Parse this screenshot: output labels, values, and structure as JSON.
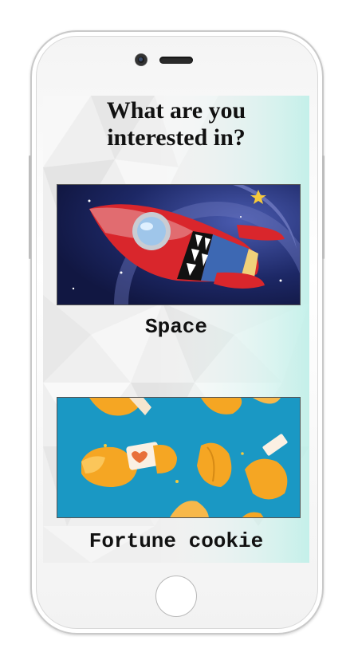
{
  "screen": {
    "title_line1": "What are you",
    "title_line2": "interested in?"
  },
  "options": [
    {
      "label": "Space",
      "image": "rocket-illustration"
    },
    {
      "label": "Fortune cookie",
      "image": "fortune-cookies-illustration"
    }
  ],
  "colors": {
    "space_bg": "#1f2a6b",
    "cookie_bg": "#1a98c4",
    "rocket_red": "#d9262c",
    "cookie_orange": "#f5a623"
  }
}
